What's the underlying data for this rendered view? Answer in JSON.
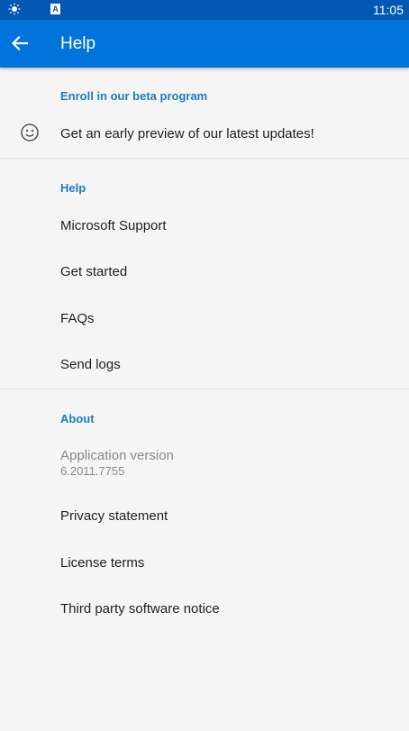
{
  "status_bar": {
    "time": "11:05",
    "icons": [
      "sun-icon",
      "font-icon"
    ],
    "font_icon_letter": "A"
  },
  "app_bar": {
    "title": "Help",
    "back_icon": "arrow-left-icon",
    "background_color": "#0074da"
  },
  "sections": {
    "beta": {
      "header": "Enroll in our beta program",
      "item_label": "Get an early preview of our latest updates!",
      "item_icon": "smiley-icon"
    },
    "help": {
      "header": "Help",
      "items": [
        "Microsoft Support",
        "Get started",
        "FAQs",
        "Send logs"
      ]
    },
    "about": {
      "header": "About",
      "version_label": "Application version",
      "version_value": "6.2011.7755",
      "items": [
        "Privacy statement",
        "License terms",
        "Third party software notice"
      ]
    }
  },
  "colors": {
    "status_bar": "#0058b3",
    "accent": "#1a7bc4",
    "background": "#f5f5f5"
  }
}
